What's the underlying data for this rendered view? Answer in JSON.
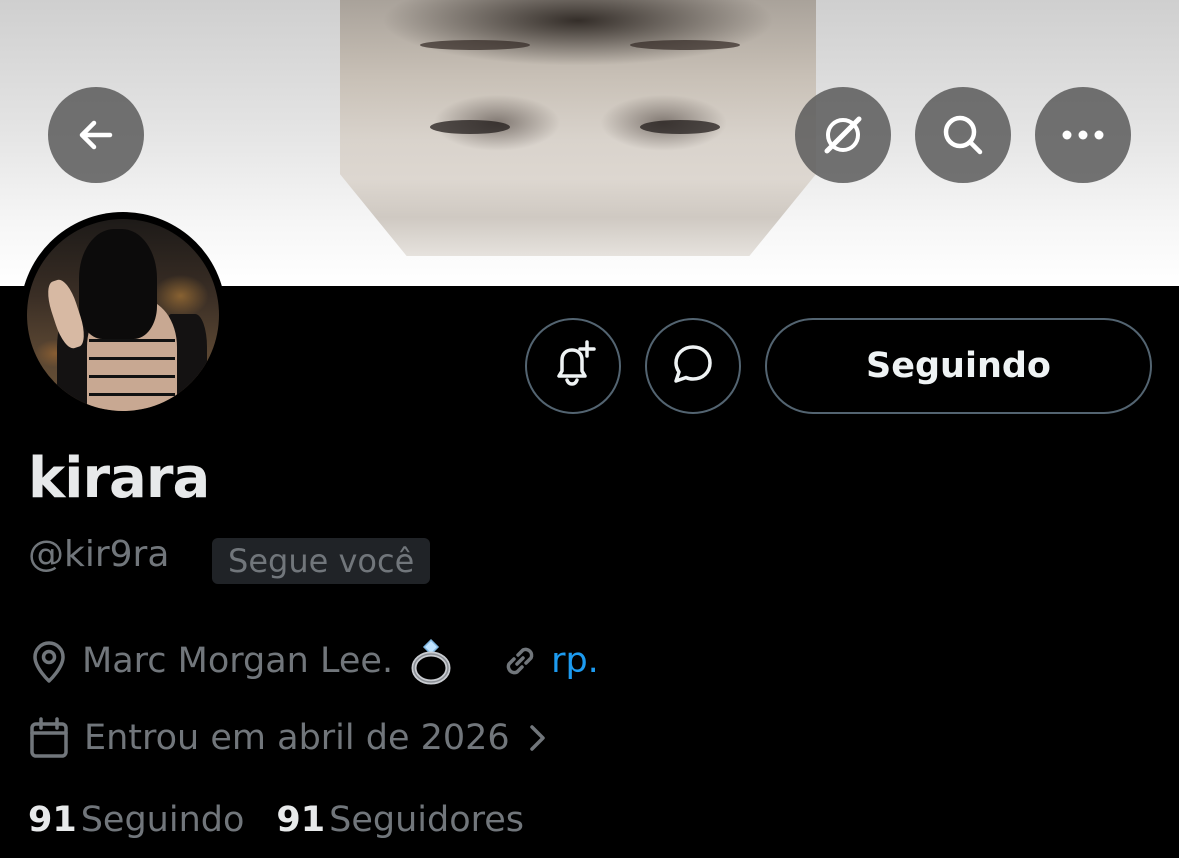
{
  "profile": {
    "display_name": "kirara",
    "handle": "@kir9ra",
    "follows_you_badge": "Segue você",
    "location": "Marc Morgan Lee.",
    "location_emoji": "💍",
    "website": "rp.",
    "joined": "Entrou em abril de 2026"
  },
  "actions": {
    "follow_state_label": "Seguindo"
  },
  "stats": {
    "following_count": "91",
    "following_label": "Seguindo",
    "followers_count": "91",
    "followers_label": "Seguidores"
  },
  "icons": {
    "back": "arrow-left-icon",
    "grok": "grok-slash-icon",
    "search": "search-icon",
    "more": "more-horizontal-icon",
    "notify": "bell-plus-icon",
    "message": "chat-bubble-icon",
    "location": "location-pin-icon",
    "link": "link-icon",
    "calendar": "calendar-icon",
    "chevron": "chevron-right-icon"
  },
  "colors": {
    "background": "#000000",
    "primary_text": "#e7e9ea",
    "secondary_text": "#71767b",
    "link": "#1d9bf0",
    "border": "#536471"
  }
}
